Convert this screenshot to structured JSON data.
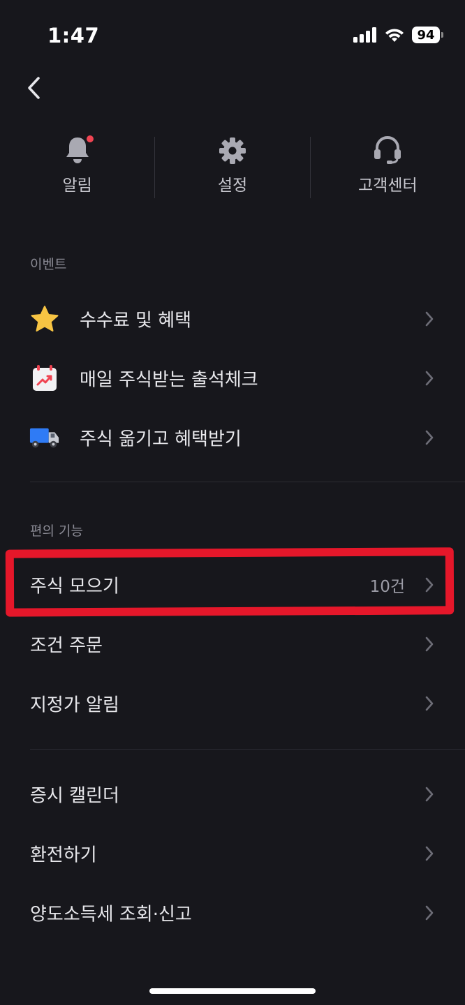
{
  "status_bar": {
    "time": "1:47",
    "battery": "94"
  },
  "quick_actions": [
    {
      "label": "알림"
    },
    {
      "label": "설정"
    },
    {
      "label": "고객센터"
    }
  ],
  "event_section": {
    "title": "이벤트",
    "items": [
      {
        "label": "수수료 및 혜택",
        "icon": "star-icon"
      },
      {
        "label": "매일 주식받는 출석체크",
        "icon": "calendar-chart-icon"
      },
      {
        "label": "주식 옮기고 혜택받기",
        "icon": "truck-icon"
      }
    ]
  },
  "convenience_section": {
    "title": "편의 기능",
    "items": [
      {
        "label": "주식 모으기",
        "value": "10건"
      },
      {
        "label": "조건 주문"
      },
      {
        "label": "지정가 알림"
      }
    ]
  },
  "other_section": {
    "items": [
      {
        "label": "증시 캘린더"
      },
      {
        "label": "환전하기"
      },
      {
        "label": "양도소득세 조회·신고"
      }
    ]
  },
  "colors": {
    "background": "#17171c",
    "highlight": "#e5172a",
    "notification_dot": "#f04452",
    "star": "#f7c443",
    "truck": "#2f7bf5"
  }
}
